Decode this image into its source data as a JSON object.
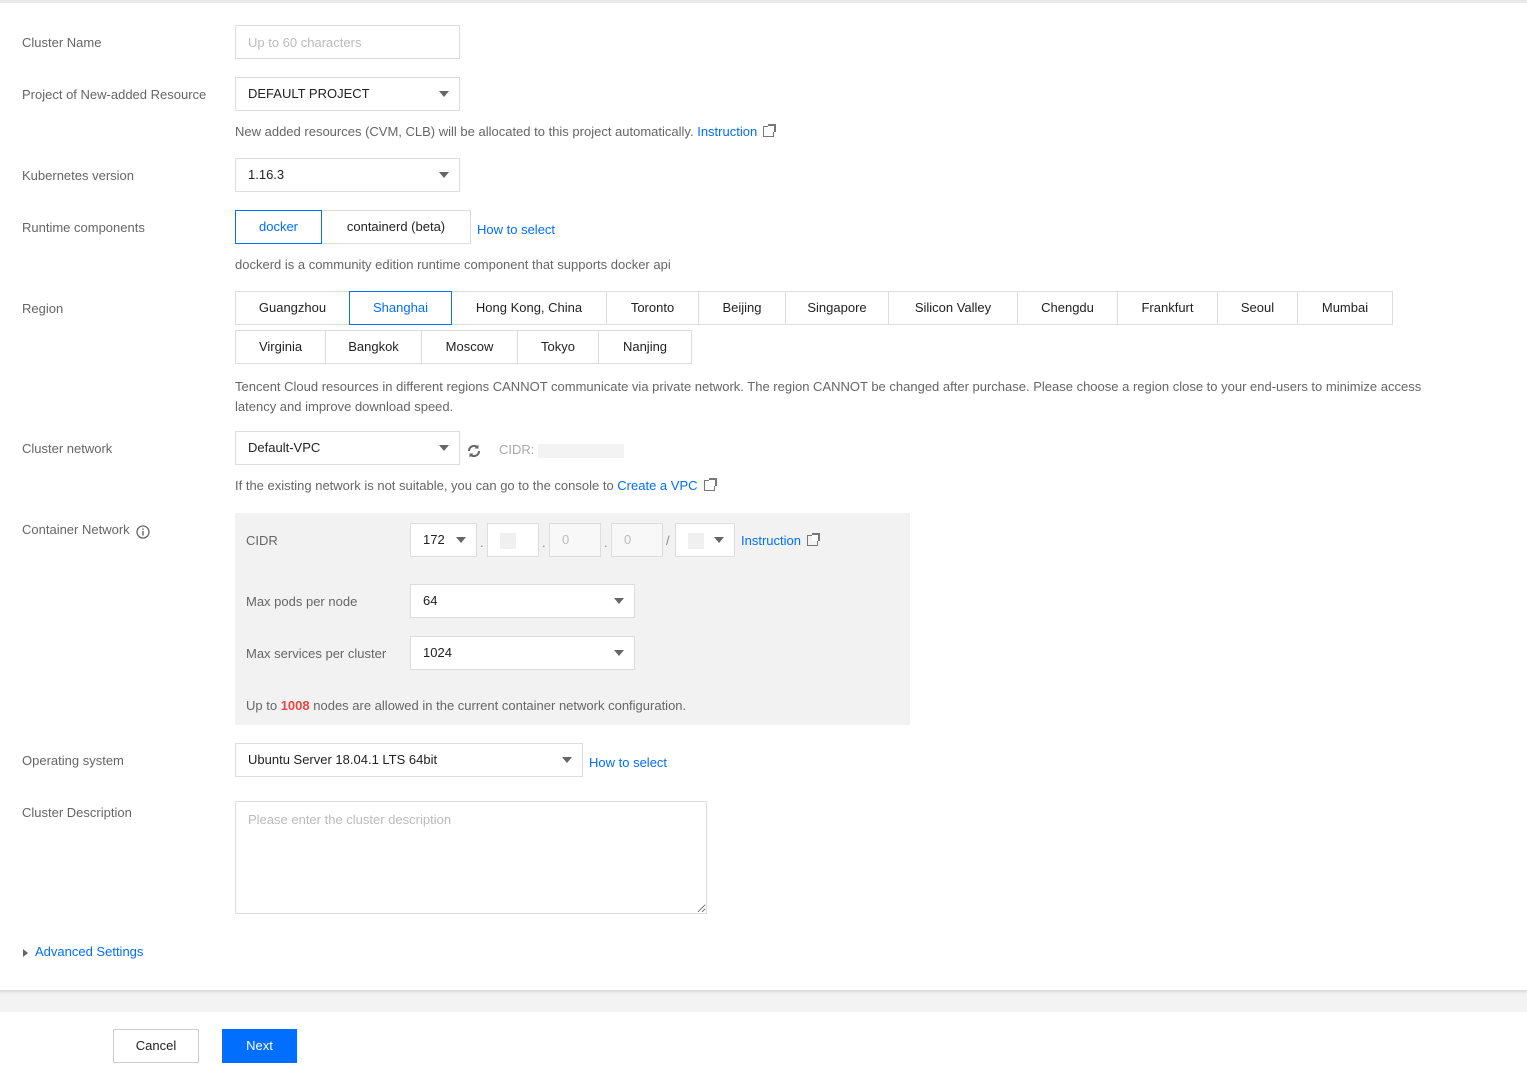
{
  "cluster_name": {
    "label": "Cluster Name",
    "placeholder": "Up to 60 characters",
    "value": ""
  },
  "project": {
    "label": "Project of New-added Resource",
    "value": "DEFAULT PROJECT",
    "help": "New added resources (CVM, CLB) will be allocated to this project automatically.",
    "help_link": "Instruction"
  },
  "k8s_version": {
    "label": "Kubernetes version",
    "value": "1.16.3"
  },
  "runtime": {
    "label": "Runtime components",
    "options": [
      "docker",
      "containerd (beta)"
    ],
    "selected": "docker",
    "link": "How to select",
    "help": "dockerd is a community edition runtime component that supports docker api"
  },
  "region": {
    "label": "Region",
    "row1": [
      "Guangzhou",
      "Shanghai",
      "Hong Kong, China",
      "Toronto",
      "Beijing",
      "Singapore",
      "Silicon Valley",
      "Chengdu",
      "Frankfurt",
      "Seoul",
      "Mumbai"
    ],
    "row2": [
      "Virginia",
      "Bangkok",
      "Moscow",
      "Tokyo",
      "Nanjing"
    ],
    "selected": "Shanghai",
    "help_line1": "Tencent Cloud resources in different regions CANNOT communicate via private network. The region CANNOT be changed after purchase. Please choose a region close to your end-users to minimize access",
    "help_line2": "latency and improve download speed."
  },
  "cluster_network": {
    "label": "Cluster network",
    "value": "Default-VPC",
    "cidr_label": "CIDR:",
    "help": "If the existing network is not suitable, you can go to the console to",
    "help_link": "Create a VPC"
  },
  "container_network": {
    "label": "Container Network",
    "cidr_label": "CIDR",
    "cidr_first": "172",
    "cidr_third": "0",
    "cidr_fourth": "0",
    "cidr_sep_dot": ".",
    "cidr_sep_slash": "/",
    "cidr_link": "Instruction",
    "max_pods_label": "Max pods per node",
    "max_pods": "64",
    "max_services_label": "Max services per cluster",
    "max_services": "1024",
    "note_prefix": "Up to",
    "note_count": "1008",
    "note_suffix": "nodes are allowed in the current container network configuration."
  },
  "os": {
    "label": "Operating system",
    "value": "Ubuntu Server 18.04.1 LTS 64bit",
    "link": "How to select"
  },
  "description": {
    "label": "Cluster Description",
    "placeholder": "Please enter the cluster description"
  },
  "advanced": {
    "label": "Advanced Settings"
  },
  "footer": {
    "cancel": "Cancel",
    "next": "Next"
  },
  "colors": {
    "accent": "#006eff",
    "danger": "#e54545",
    "panel": "#f2f2f2"
  }
}
